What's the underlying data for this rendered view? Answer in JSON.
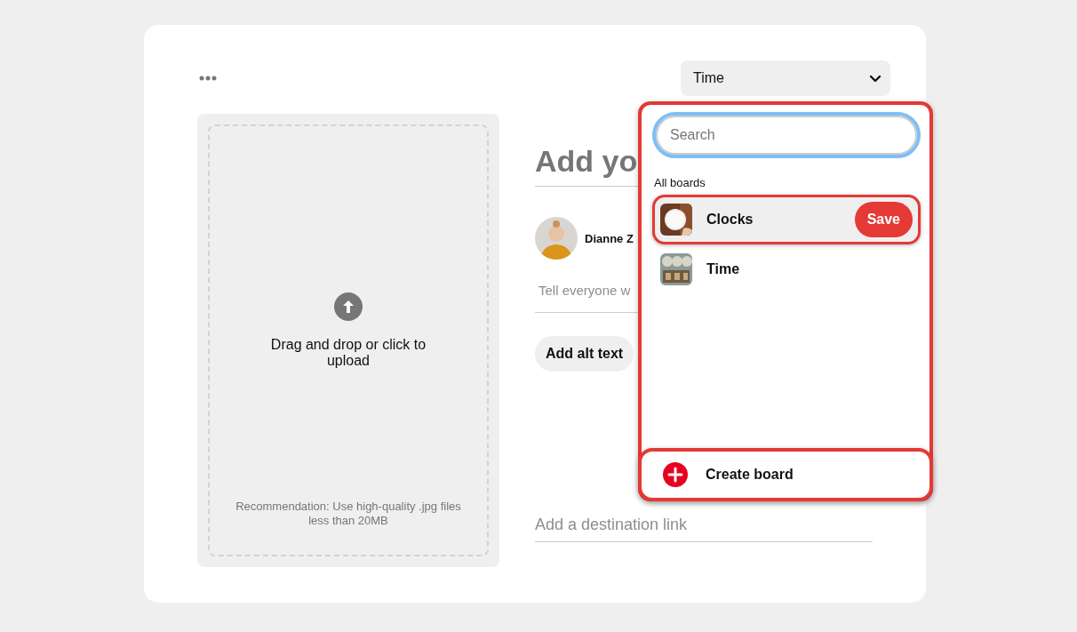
{
  "board_select": {
    "value": "Time"
  },
  "upload": {
    "text": "Drag and drop or click to upload",
    "note": "Recommendation: Use high-quality .jpg files less than 20MB"
  },
  "pin_form": {
    "title": "Add yo",
    "author": "Dianne Z",
    "description": {
      "placeholder": "Tell everyone w"
    },
    "alt_text_button": "Add alt text",
    "link": {
      "placeholder": "Add a destination link"
    }
  },
  "board_picker": {
    "search": {
      "placeholder": "Search"
    },
    "section": "All boards",
    "boards": [
      {
        "name": "Clocks",
        "selected": true,
        "action": "Save"
      },
      {
        "name": "Time",
        "selected": false
      }
    ],
    "create": "Create board"
  }
}
